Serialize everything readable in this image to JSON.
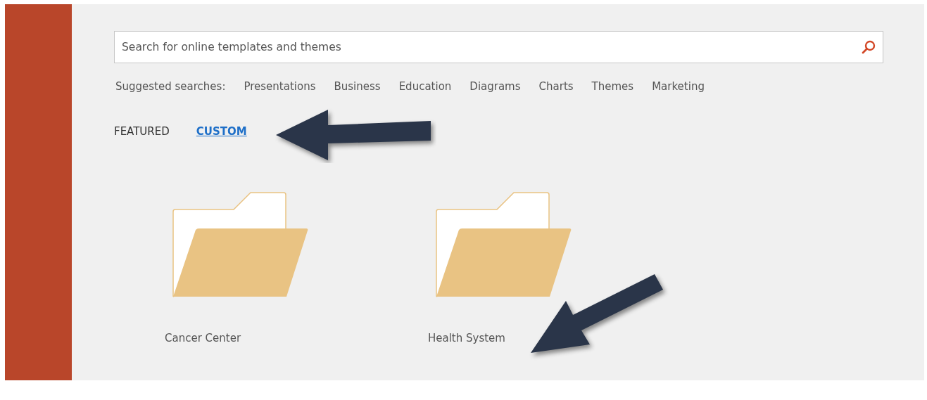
{
  "search": {
    "placeholder": "Search for online templates and themes"
  },
  "suggested": {
    "label": "Suggested searches:",
    "items": [
      "Presentations",
      "Business",
      "Education",
      "Diagrams",
      "Charts",
      "Themes",
      "Marketing"
    ]
  },
  "tabs": [
    {
      "label": "FEATURED",
      "selected": false
    },
    {
      "label": "CUSTOM",
      "selected": true
    }
  ],
  "folders": [
    {
      "name": "Cancer Center"
    },
    {
      "name": "Health System"
    }
  ]
}
